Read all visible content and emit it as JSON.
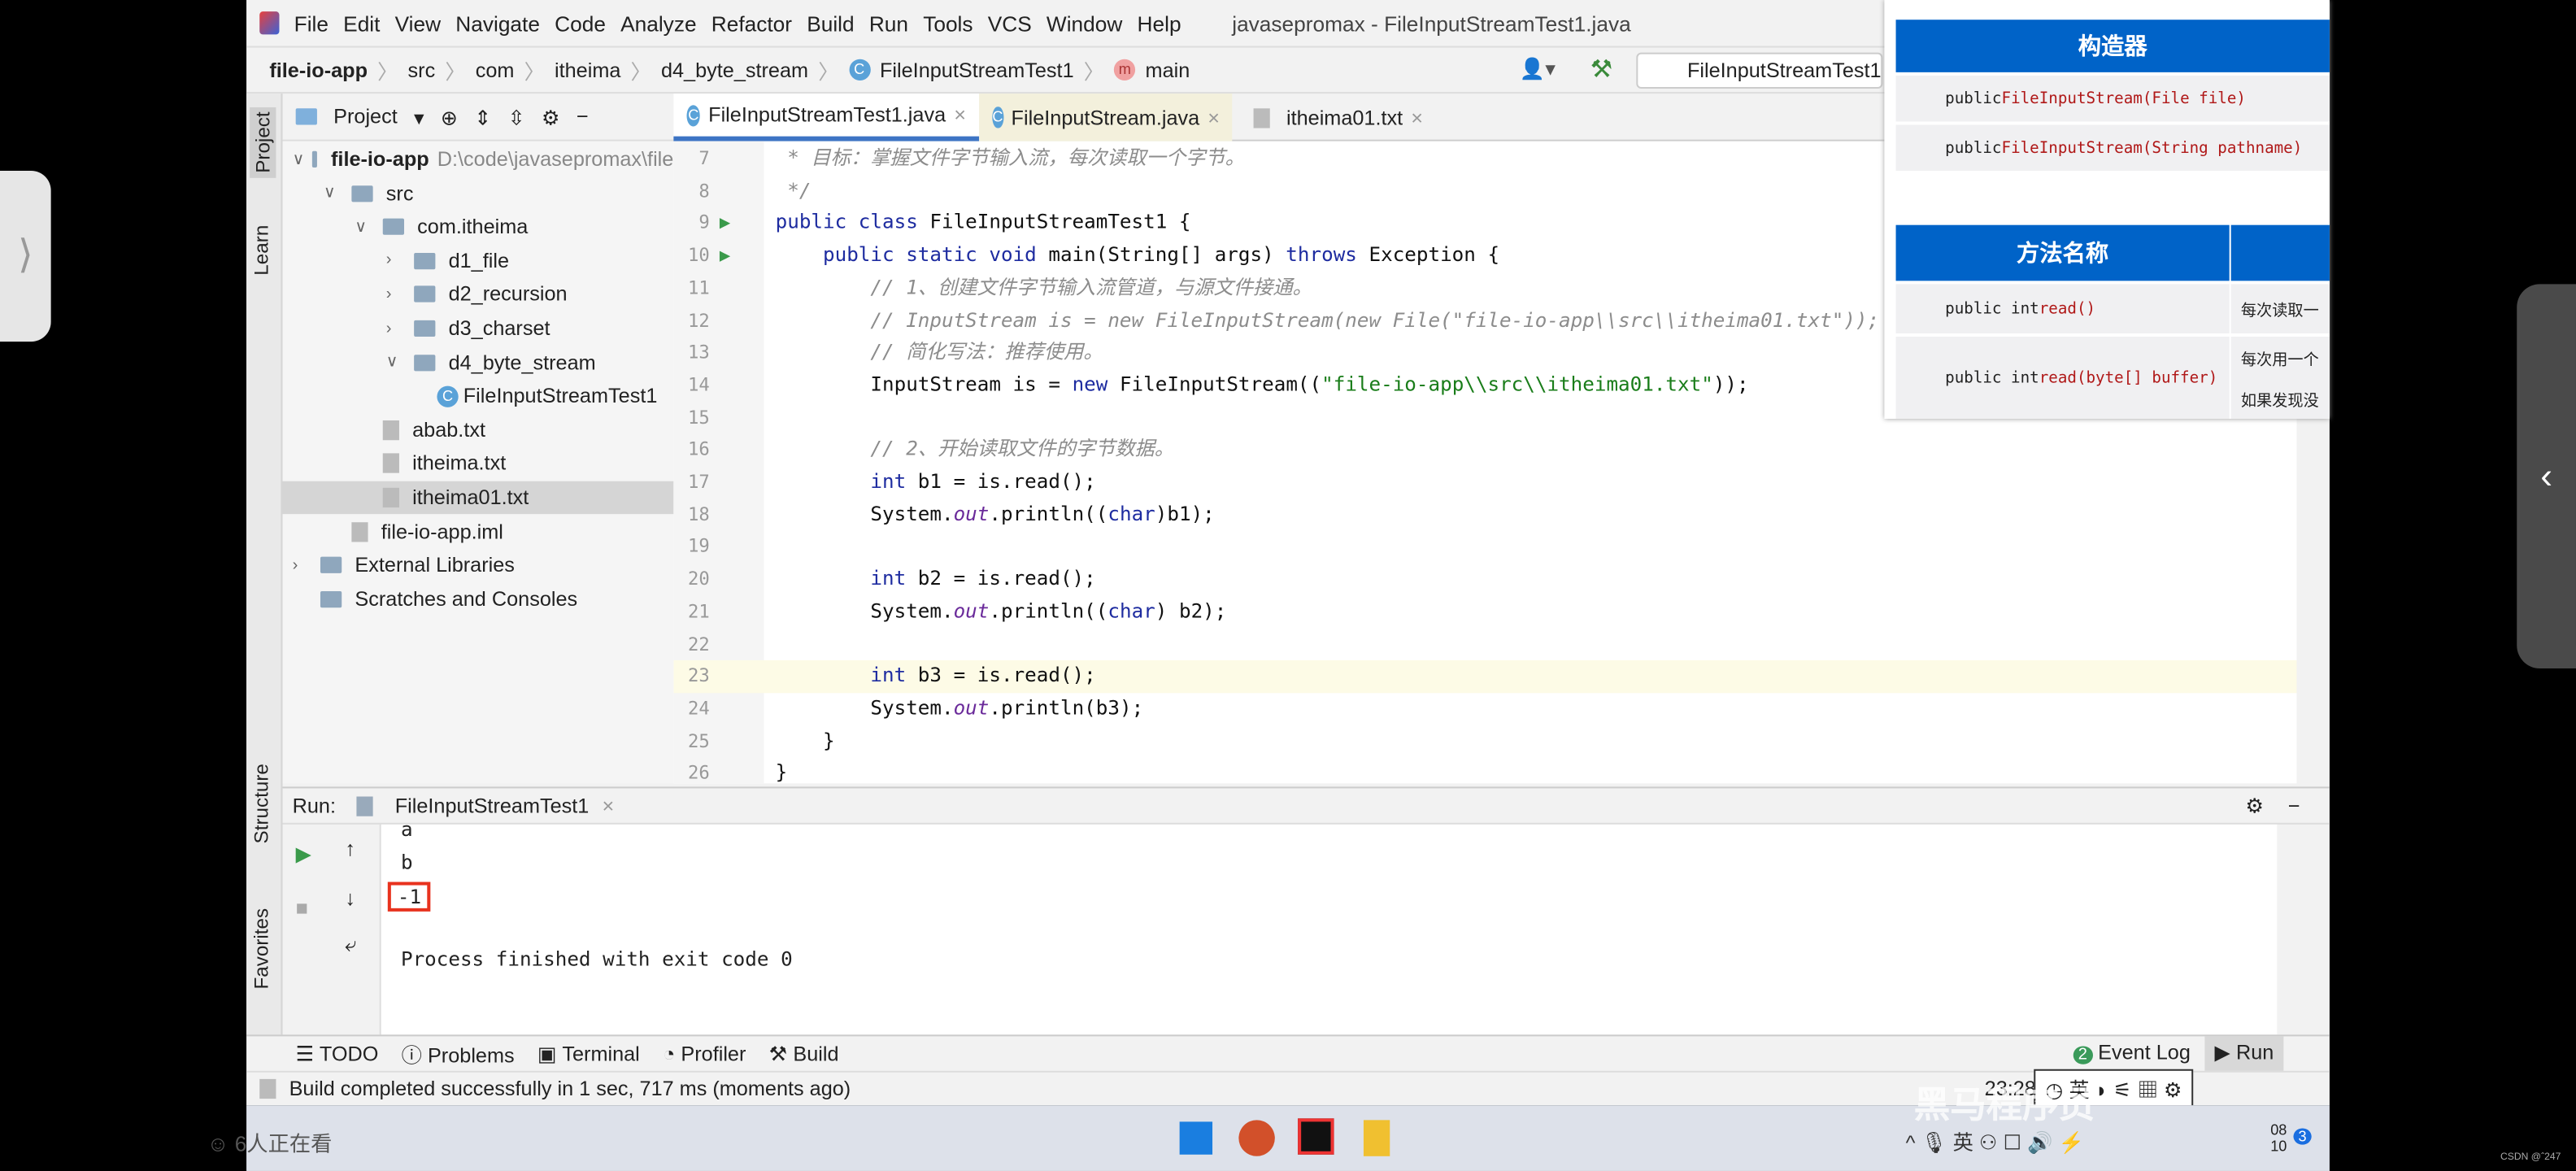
{
  "menu": {
    "items": [
      "File",
      "Edit",
      "View",
      "Navigate",
      "Code",
      "Analyze",
      "Refactor",
      "Build",
      "Run",
      "Tools",
      "VCS",
      "Window",
      "Help"
    ],
    "window_title": "javasepromax - FileInputStreamTest1.java"
  },
  "breadcrumb": [
    "file-io-app",
    "src",
    "com",
    "itheima",
    "d4_byte_stream",
    "FileInputStreamTest1",
    "main"
  ],
  "run_config": "FileInputStreamTest1",
  "side_tabs": {
    "project": "Project",
    "learn": "Learn",
    "structure": "Structure",
    "favorites": "Favorites"
  },
  "project": {
    "label": "Project",
    "tree": [
      {
        "label": "file-io-app",
        "extra": "D:\\code\\javasepromax\\file",
        "depth": 0,
        "kind": "module",
        "open": true,
        "bold": true
      },
      {
        "label": "src",
        "depth": 1,
        "kind": "folder",
        "open": true
      },
      {
        "label": "com.itheima",
        "depth": 2,
        "kind": "folder",
        "open": true
      },
      {
        "label": "d1_file",
        "depth": 3,
        "kind": "folder",
        "open": false
      },
      {
        "label": "d2_recursion",
        "depth": 3,
        "kind": "folder",
        "open": false
      },
      {
        "label": "d3_charset",
        "depth": 3,
        "kind": "folder",
        "open": false
      },
      {
        "label": "d4_byte_stream",
        "depth": 3,
        "kind": "folder",
        "open": true
      },
      {
        "label": "FileInputStreamTest1",
        "depth": 4,
        "kind": "class"
      },
      {
        "label": "abab.txt",
        "depth": 2,
        "kind": "file"
      },
      {
        "label": "itheima.txt",
        "depth": 2,
        "kind": "file"
      },
      {
        "label": "itheima01.txt",
        "depth": 2,
        "kind": "file",
        "selected": true
      },
      {
        "label": "file-io-app.iml",
        "depth": 1,
        "kind": "file"
      },
      {
        "label": "External Libraries",
        "depth": 0,
        "kind": "lib",
        "open": false
      },
      {
        "label": "Scratches and Consoles",
        "depth": 0,
        "kind": "scratch"
      }
    ]
  },
  "tabs": [
    {
      "label": "FileInputStreamTest1.java",
      "active": true
    },
    {
      "label": "FileInputStream.java"
    },
    {
      "label": "itheima01.txt"
    }
  ],
  "code": [
    {
      "n": 7,
      "seg": [
        [
          "cm",
          " * 目标：掌握文件字节输入流，每次读取一个字节。"
        ]
      ]
    },
    {
      "n": 8,
      "seg": [
        [
          "cm",
          " */"
        ]
      ]
    },
    {
      "n": 9,
      "run": true,
      "seg": [
        [
          "kw",
          "public class "
        ],
        [
          "pl",
          "FileInputStreamTest1 {"
        ]
      ]
    },
    {
      "n": 10,
      "run": true,
      "seg": [
        [
          "kw",
          "    public static void "
        ],
        [
          "pl",
          "main(String[] args) "
        ],
        [
          "kw",
          "throws "
        ],
        [
          "pl",
          "Exception {"
        ]
      ]
    },
    {
      "n": 11,
      "seg": [
        [
          "cm",
          "        // 1、创建文件字节输入流管道，与源文件接通。"
        ]
      ]
    },
    {
      "n": 12,
      "seg": [
        [
          "cm",
          "        // InputStream is = new FileInputStream(new File(\"file-io-app\\\\src\\\\itheima01.txt\"));"
        ]
      ]
    },
    {
      "n": 13,
      "seg": [
        [
          "cm",
          "        // 简化写法：推荐使用。"
        ]
      ]
    },
    {
      "n": 14,
      "seg": [
        [
          "pl",
          "        InputStream is = "
        ],
        [
          "kw",
          "new "
        ],
        [
          "pl",
          "FileInputStream(("
        ],
        [
          "st",
          "\"file-io-app\\\\src\\\\itheima01.txt\""
        ],
        [
          "pl",
          "));"
        ]
      ]
    },
    {
      "n": 15,
      "seg": []
    },
    {
      "n": 16,
      "seg": [
        [
          "cm",
          "        // 2、开始读取文件的字节数据。"
        ]
      ]
    },
    {
      "n": 17,
      "seg": [
        [
          "kw",
          "        int "
        ],
        [
          "pl",
          "b1 = is.read();"
        ]
      ]
    },
    {
      "n": 18,
      "seg": [
        [
          "pl",
          "        System."
        ],
        [
          "it",
          "out"
        ],
        [
          "pl",
          ".println(("
        ],
        [
          "kw",
          "char"
        ],
        [
          "pl",
          ")b1);"
        ]
      ]
    },
    {
      "n": 19,
      "seg": []
    },
    {
      "n": 20,
      "seg": [
        [
          "kw",
          "        int "
        ],
        [
          "pl",
          "b2 = is.read();"
        ]
      ]
    },
    {
      "n": 21,
      "seg": [
        [
          "pl",
          "        System."
        ],
        [
          "it",
          "out"
        ],
        [
          "pl",
          ".println(("
        ],
        [
          "kw",
          "char"
        ],
        [
          "pl",
          ") b2);"
        ]
      ]
    },
    {
      "n": 22,
      "seg": []
    },
    {
      "n": 23,
      "hl": true,
      "seg": [
        [
          "kw",
          "        int "
        ],
        [
          "pl",
          "b3 = is.read();"
        ]
      ]
    },
    {
      "n": 24,
      "seg": [
        [
          "pl",
          "        System."
        ],
        [
          "it",
          "out"
        ],
        [
          "pl",
          ".println(b3);"
        ]
      ]
    },
    {
      "n": 25,
      "seg": [
        [
          "pl",
          "    }"
        ]
      ]
    },
    {
      "n": 26,
      "seg": [
        [
          "pl",
          "}"
        ]
      ]
    }
  ],
  "run": {
    "label": "Run:",
    "tab": "FileInputStreamTest1",
    "output": [
      "a",
      "b",
      "-1",
      "",
      "Process finished with exit code 0"
    ],
    "highlight_color": "#e8321e"
  },
  "bottom_tools": [
    "TODO",
    "Problems",
    "Terminal",
    "Profiler",
    "Build"
  ],
  "event_log": {
    "count": "2",
    "label": "Event Log"
  },
  "run_button": "Run",
  "status": {
    "message": "Build completed successfully in 1 sec, 717 ms (moments ago)",
    "time": "23:28"
  },
  "slide": {
    "ctor_header": "构造器",
    "ctors": [
      [
        "public ",
        "FileInputStream(File file)"
      ],
      [
        "public ",
        "FileInputStream(String pathname)"
      ]
    ],
    "method_header": "方法名称",
    "methods": [
      {
        "sig": [
          "public int ",
          "read()"
        ],
        "desc": [
          "每次读取一"
        ]
      },
      {
        "sig": [
          "public int ",
          "read(byte[] buffer)"
        ],
        "desc": [
          "每次用一个",
          "如果发现没"
        ]
      }
    ]
  },
  "overlay": {
    "viewers": "6人正在看",
    "watermark": "黑马程序员",
    "ime": "英",
    "date": "08\n10",
    "notif": "3",
    "csdn": "CSDN @ˆ247"
  },
  "colors": {
    "accent": "#0063c8",
    "keyword": "#1e2ca0",
    "string": "#1a7d1a"
  }
}
